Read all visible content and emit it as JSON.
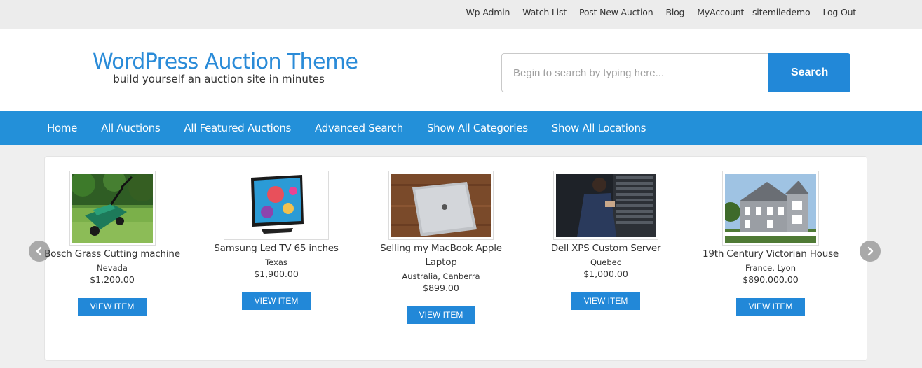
{
  "topbar": {
    "links": [
      "Wp-Admin",
      "Watch List",
      "Post New Auction",
      "Blog",
      "MyAccount - sitemiledemo",
      "Log Out"
    ]
  },
  "brand": {
    "title": "WordPress Auction Theme",
    "tagline": "build yourself an auction site in minutes"
  },
  "search": {
    "placeholder": "Begin to search by typing here...",
    "button_label": "Search"
  },
  "nav": {
    "items": [
      "Home",
      "All Auctions",
      "All Featured Auctions",
      "Advanced Search",
      "Show All Categories",
      "Show All Locations"
    ]
  },
  "carousel": {
    "items": [
      {
        "title": "Bosch Grass Cutting machine",
        "location": "Nevada",
        "price": "$1,200.00",
        "button": "VIEW ITEM"
      },
      {
        "title": "Samsung Led TV 65 inches",
        "location": "Texas",
        "price": "$1,900.00",
        "button": "VIEW ITEM"
      },
      {
        "title": "Selling my MacBook Apple Laptop",
        "location": "Australia, Canberra",
        "price": "$899.00",
        "button": "VIEW ITEM"
      },
      {
        "title": "Dell XPS Custom Server",
        "location": "Quebec",
        "price": "$1,000.00",
        "button": "VIEW ITEM"
      },
      {
        "title": "19th Century Victorian House",
        "location": "France, Lyon",
        "price": "$890,000.00",
        "button": "VIEW ITEM"
      }
    ],
    "arrow_icons": [
      "chevron-left-icon",
      "chevron-right-icon"
    ]
  },
  "colors": {
    "accent": "#2288d8",
    "nav_bg": "#2390d9",
    "brand_title": "#2a8bd8",
    "arrow_bg": "#a9a9a9"
  }
}
